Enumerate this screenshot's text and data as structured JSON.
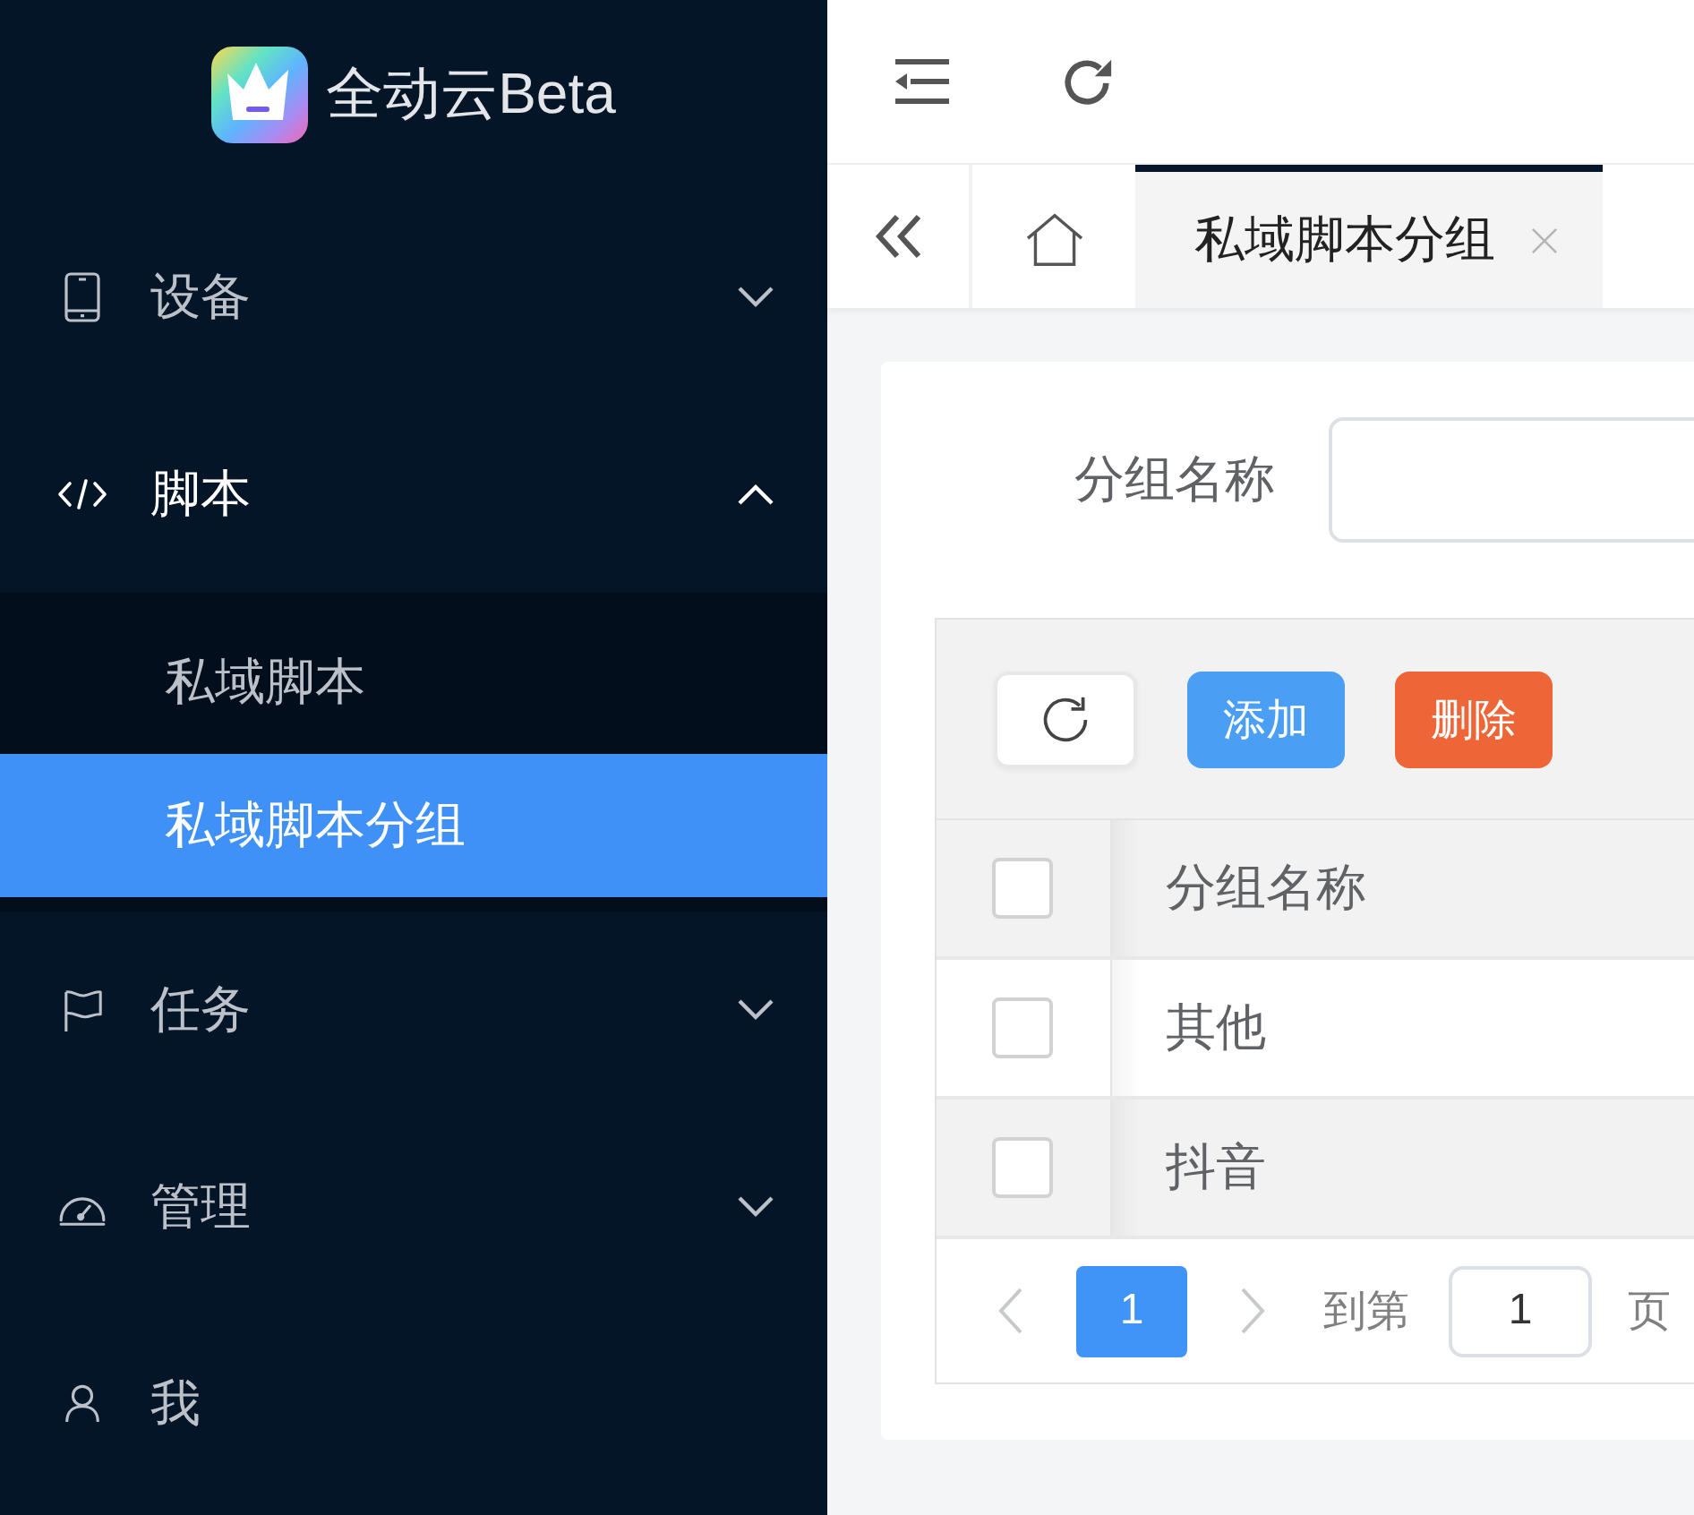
{
  "sidebar": {
    "logo_text": "全动云Beta",
    "items": [
      {
        "kind": "group",
        "label": "设备",
        "expanded": false
      },
      {
        "kind": "group",
        "label": "脚本",
        "expanded": true,
        "children": [
          {
            "label": "私域脚本",
            "selected": false
          },
          {
            "label": "私域脚本分组",
            "selected": true
          }
        ]
      },
      {
        "kind": "group",
        "label": "任务",
        "expanded": false
      },
      {
        "kind": "group",
        "label": "管理",
        "expanded": false
      },
      {
        "kind": "link",
        "label": "我"
      }
    ]
  },
  "tabs": [
    {
      "kind": "home",
      "selected": false
    },
    {
      "kind": "page",
      "label": "私域脚本分组",
      "selected": true
    }
  ],
  "filter": {
    "label": "分组名称"
  },
  "toolbar": {
    "buttons": [
      {
        "kind": "refresh"
      },
      {
        "kind": "primary",
        "label": "添加"
      },
      {
        "kind": "danger",
        "label": "删除"
      }
    ]
  },
  "table": {
    "header_checked": false,
    "columns": [
      "分组名称"
    ],
    "rows": [
      {
        "checked": false,
        "cells": [
          "其他"
        ]
      },
      {
        "checked": false,
        "cells": [
          "抖音"
        ]
      }
    ]
  },
  "pagination": {
    "prev_disabled": true,
    "next_disabled": true,
    "pages": [
      {
        "label": "1",
        "selected": true
      }
    ],
    "jump_label": "到第",
    "jump_value": "1",
    "page_suffix": "页"
  }
}
